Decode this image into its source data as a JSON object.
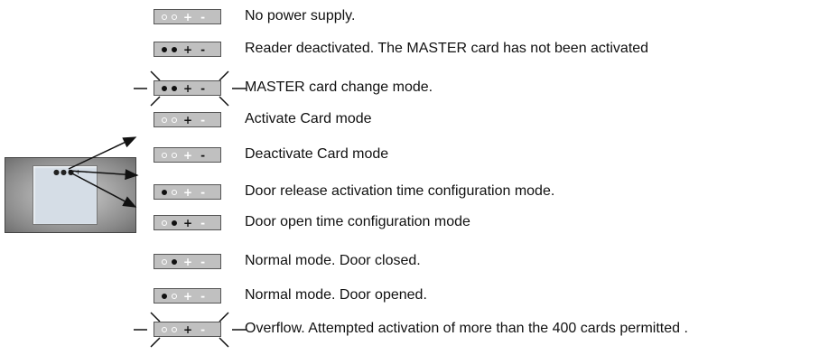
{
  "device": {
    "indicator_text": "●●●+ -"
  },
  "rows": [
    {
      "text": "No power supply.",
      "leds": [
        "off",
        "off",
        "off",
        "off"
      ],
      "blink": false
    },
    {
      "text": "Reader deactivated. The MASTER card has not been activated",
      "leds": [
        "on",
        "on",
        "on",
        "on"
      ],
      "blink": false
    },
    {
      "text": "MASTER card change mode.",
      "leds": [
        "on",
        "on",
        "on",
        "on"
      ],
      "blink": true
    },
    {
      "text": "Activate Card mode",
      "leds": [
        "off",
        "off",
        "on",
        "off"
      ],
      "blink": false
    },
    {
      "text": "Deactivate Card mode",
      "leds": [
        "off",
        "off",
        "off",
        "on"
      ],
      "blink": false
    },
    {
      "text": "Door release activation time configuration mode.",
      "leds": [
        "on",
        "off",
        "off",
        "off"
      ],
      "blink": false
    },
    {
      "text": "Door open time configuration mode",
      "leds": [
        "off",
        "on",
        "on",
        "off"
      ],
      "blink": false
    },
    {
      "text": "Normal mode. Door closed.",
      "leds": [
        "off",
        "on",
        "off",
        "off"
      ],
      "blink": false
    },
    {
      "text": "Normal mode. Door opened.",
      "leds": [
        "on",
        "off",
        "off",
        "off"
      ],
      "blink": false
    },
    {
      "text": "Overflow. Attempted activation of more than the 400 cards permitted .",
      "leds": [
        "off",
        "off",
        "on",
        "off"
      ],
      "blink": true
    }
  ]
}
